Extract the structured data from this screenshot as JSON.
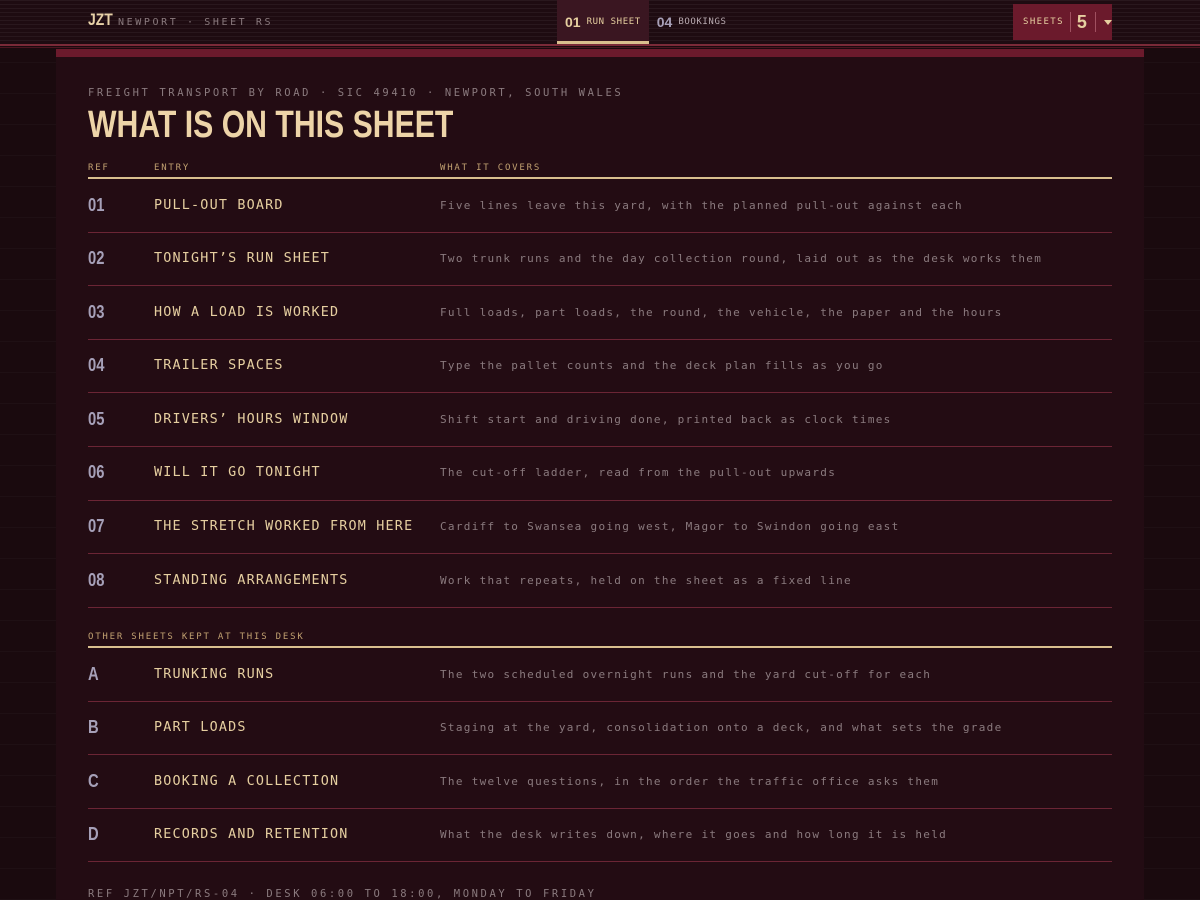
{
  "brand": {
    "mark": "JZT",
    "subtitle": "NEWPORT · SHEET RS"
  },
  "tabs": [
    {
      "num": "01",
      "label": "RUN SHEET",
      "active": true
    },
    {
      "num": "04",
      "label": "BOOKINGS",
      "active": false
    }
  ],
  "sheets_menu": {
    "label": "SHEETS",
    "count": "5",
    "icon": "chevron-down-icon"
  },
  "header": {
    "kicker": "FREIGHT TRANSPORT BY ROAD · SIC 49410 · NEWPORT, SOUTH WALES",
    "title": "WHAT IS ON THIS SHEET"
  },
  "columns": {
    "ref": "REF",
    "entry": "ENTRY",
    "covers": "WHAT IT COVERS"
  },
  "entries": [
    {
      "ref": "01",
      "entry": "PULL-OUT BOARD",
      "covers": "Five lines leave this yard, with the planned pull-out against each"
    },
    {
      "ref": "02",
      "entry": "TONIGHT’S RUN SHEET",
      "covers": "Two trunk runs and the day collection round, laid out as the desk works them"
    },
    {
      "ref": "03",
      "entry": "HOW A LOAD IS WORKED",
      "covers": "Full loads, part loads, the round, the vehicle, the paper and the hours"
    },
    {
      "ref": "04",
      "entry": "TRAILER SPACES",
      "covers": "Type the pallet counts and the deck plan fills as you go"
    },
    {
      "ref": "05",
      "entry": "DRIVERS’ HOURS WINDOW",
      "covers": "Shift start and driving done, printed back as clock times"
    },
    {
      "ref": "06",
      "entry": "WILL IT GO TONIGHT",
      "covers": "The cut-off ladder, read from the pull-out upwards"
    },
    {
      "ref": "07",
      "entry": "THE STRETCH WORKED FROM HERE",
      "covers": "Cardiff to Swansea going west, Magor to Swindon going east"
    },
    {
      "ref": "08",
      "entry": "STANDING ARRANGEMENTS",
      "covers": "Work that repeats, held on the sheet as a fixed line"
    }
  ],
  "other_sheets": {
    "heading": "OTHER SHEETS KEPT AT THIS DESK",
    "items": [
      {
        "ref": "A",
        "entry": "TRUNKING RUNS",
        "covers": "The two scheduled overnight runs and the yard cut-off for each"
      },
      {
        "ref": "B",
        "entry": "PART LOADS",
        "covers": "Staging at the yard, consolidation onto a deck, and what sets the grade"
      },
      {
        "ref": "C",
        "entry": "BOOKING A COLLECTION",
        "covers": "The twelve questions, in the order the traffic office asks them"
      },
      {
        "ref": "D",
        "entry": "RECORDS AND RETENTION",
        "covers": "What the desk writes down, where it goes and how long it is held"
      }
    ]
  },
  "footer": {
    "text": "REF JZT/NPT/RS-04 · DESK 06:00 TO 18:00, MONDAY TO FRIDAY"
  },
  "colors": {
    "background": "#1a0a0e",
    "panel": "#230c13",
    "accent": "#6b1a2c",
    "heading": "#edd4a8",
    "rule": "#d9bf8e",
    "muted_text": "#8a7a7e"
  }
}
